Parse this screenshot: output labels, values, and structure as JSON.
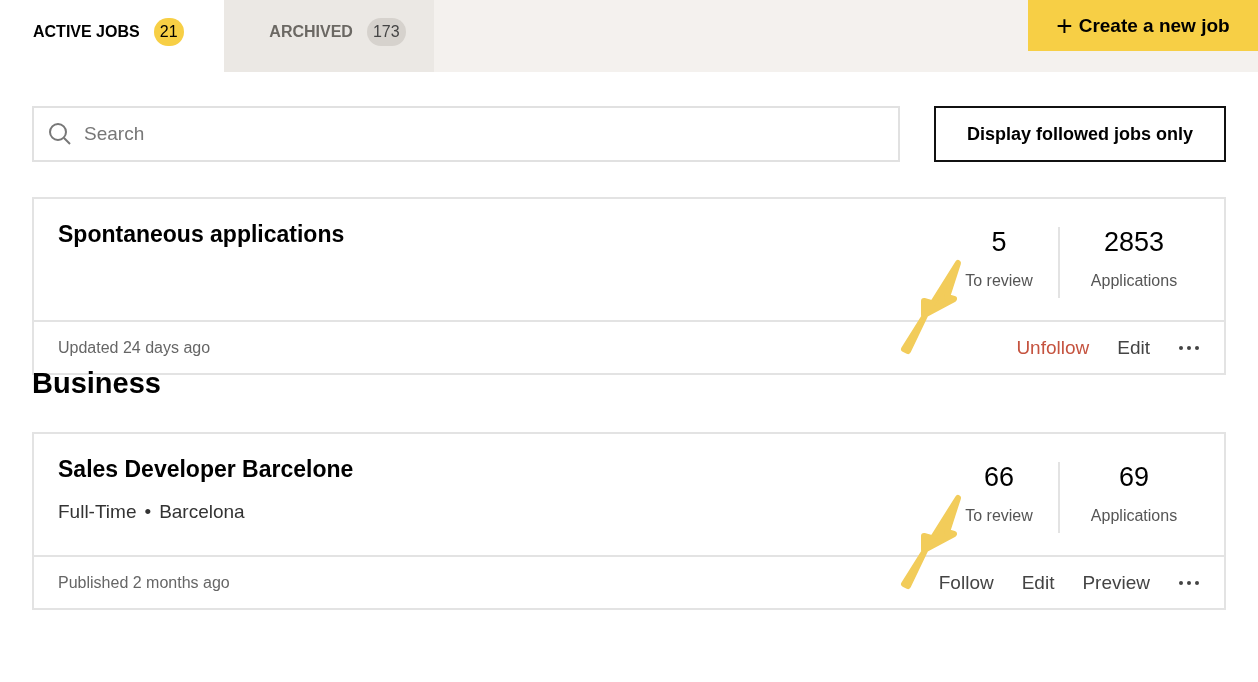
{
  "tabs": [
    {
      "label": "ACTIVE JOBS",
      "count": "21",
      "selected": true
    },
    {
      "label": "ARCHIVED",
      "count": "173",
      "selected": false
    }
  ],
  "create_button": {
    "icon": "+",
    "label": "Create a new job"
  },
  "search": {
    "placeholder": "Search"
  },
  "filter_button": "Display followed jobs only",
  "sections": [
    {
      "jobs": [
        {
          "title": "Spontaneous applications",
          "stats": [
            {
              "value": "5",
              "label": "To review"
            },
            {
              "value": "2853",
              "label": "Applications"
            }
          ],
          "footer_text": "Updated 24 days ago",
          "actions": [
            {
              "label": "Unfollow",
              "kind": "unfollow"
            },
            {
              "label": "Edit",
              "kind": "link"
            }
          ],
          "annotation_arrow": true
        }
      ]
    },
    {
      "title": "Business",
      "jobs": [
        {
          "title": "Sales Developer Barcelone",
          "details": [
            "Full-Time",
            "Barcelona"
          ],
          "separator": "•",
          "stats": [
            {
              "value": "66",
              "label": "To review"
            },
            {
              "value": "69",
              "label": "Applications"
            }
          ],
          "footer_text": "Published 2 months ago",
          "actions": [
            {
              "label": "Follow",
              "kind": "link"
            },
            {
              "label": "Edit",
              "kind": "link"
            },
            {
              "label": "Preview",
              "kind": "link"
            }
          ],
          "annotation_arrow": true
        }
      ]
    }
  ]
}
